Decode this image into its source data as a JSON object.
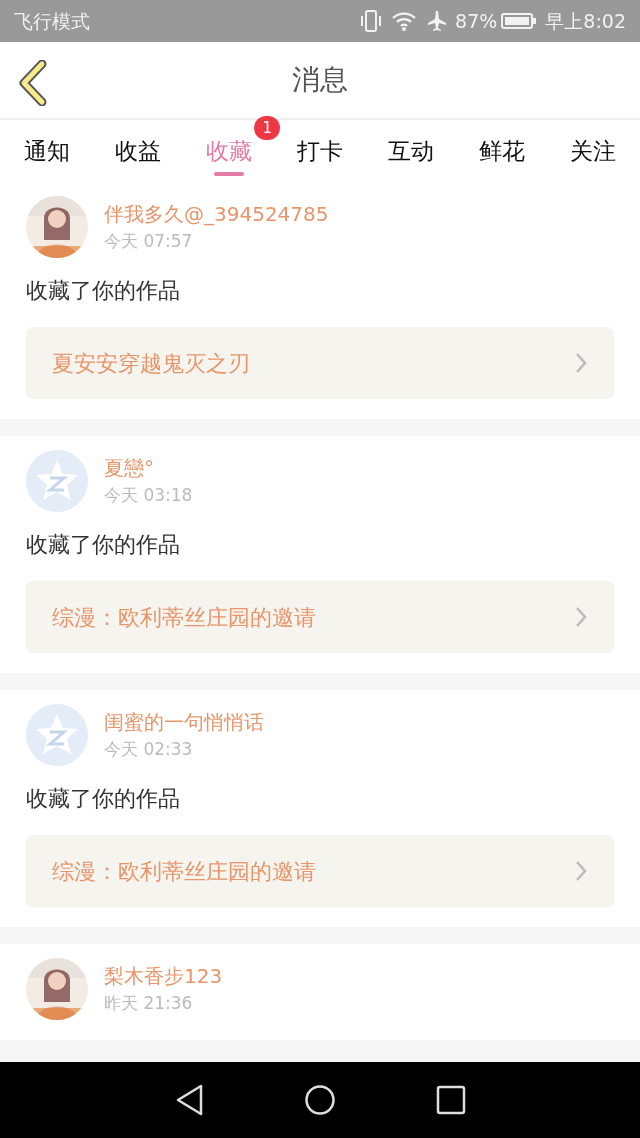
{
  "status_bar": {
    "left": "飞行模式",
    "battery": "87%",
    "time": "早上8:02"
  },
  "header": {
    "title": "消息"
  },
  "tabs": [
    {
      "label": "通知",
      "selected": false
    },
    {
      "label": "收益",
      "selected": false
    },
    {
      "label": "收藏",
      "selected": true,
      "badge": "1"
    },
    {
      "label": "打卡",
      "selected": false
    },
    {
      "label": "互动",
      "selected": false
    },
    {
      "label": "鲜花",
      "selected": false
    },
    {
      "label": "关注",
      "selected": false
    }
  ],
  "messages": [
    {
      "user": "伴我多久@_394524785",
      "time": "今天 07:57",
      "action": "收藏了你的作品",
      "work": "夏安安穿越鬼灭之刃"
    },
    {
      "avatar": {
        "kind": "default"
      },
      "user": "夏戀°",
      "time": "今天 03:18",
      "action": "收藏了你的作品",
      "work": "综漫：欧利蒂丝庄园的邀请"
    },
    {
      "avatar": {
        "kind": "default"
      },
      "user": "闺蜜的一句悄悄话",
      "time": "今天 02:33",
      "action": "收藏了你的作品",
      "work": "综漫：欧利蒂丝庄园的邀请"
    },
    {
      "user": "梨木香步123",
      "time": "昨天 21:36"
    }
  ]
}
